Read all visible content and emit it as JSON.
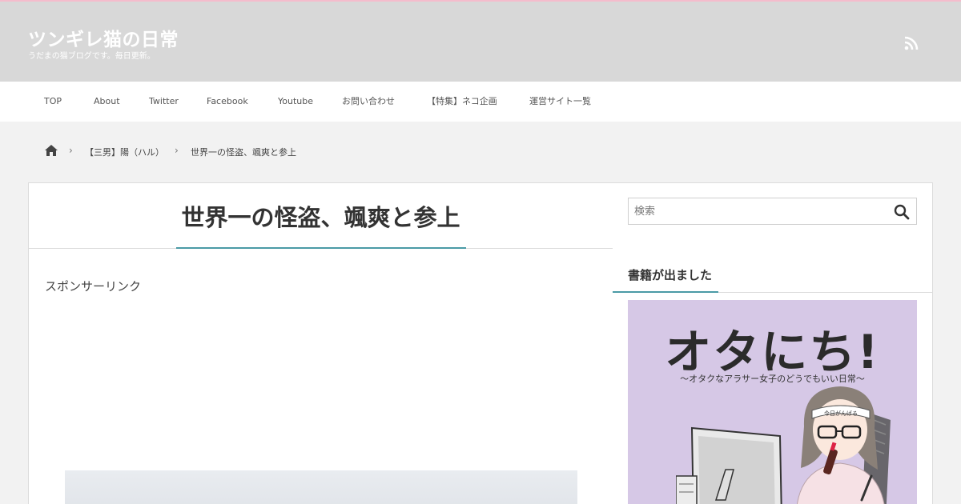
{
  "header": {
    "site_title": "ツンギレ猫の日常",
    "site_description": "うだまの猫ブログです。毎日更新。",
    "rss_icon": "rss-icon"
  },
  "nav": {
    "items": [
      {
        "label": "TOP"
      },
      {
        "label": "About"
      },
      {
        "label": "Twitter"
      },
      {
        "label": "Facebook"
      },
      {
        "label": "Youtube"
      },
      {
        "label": "お問い合わせ"
      },
      {
        "label": "【特集】ネコ企画"
      },
      {
        "label": "運営サイト一覧"
      }
    ]
  },
  "breadcrumb": {
    "home_icon": "home-icon",
    "items": [
      {
        "label": "【三男】陽（ハル）"
      },
      {
        "label": "世界一の怪盗、颯爽と参上"
      }
    ],
    "separator": "›"
  },
  "post": {
    "title": "世界一の怪盗、颯爽と参上",
    "sponsor_label": "スポンサーリンク"
  },
  "sidebar": {
    "search_placeholder": "検索",
    "search_icon": "search-icon",
    "widget_title": "書籍が出ました",
    "book": {
      "title": "オタにち!",
      "subtitle": "〜オタクなアラサー女子のどうでもいい日常〜",
      "headband_text": "今日がんばる"
    }
  },
  "colors": {
    "header_bg": "#d8d8d8",
    "accent_line": "#4a9aa6",
    "top_border": "#f4bccc",
    "book_bg": "#d6c8e6"
  }
}
